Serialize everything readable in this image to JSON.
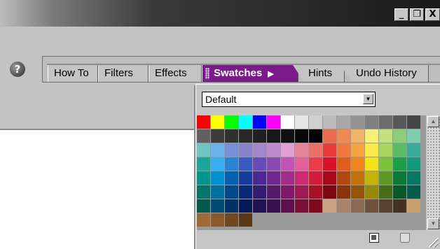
{
  "window": {
    "minimize_label": "_",
    "restore_label": "❐",
    "close_label": "X"
  },
  "help": {
    "label": "?"
  },
  "tabs": {
    "how_to": "How To",
    "filters": "Filters",
    "effects": "Effects",
    "swatches": "Swatches",
    "swatches_arrow": "▶",
    "hints": "Hints",
    "undo_history": "Undo History"
  },
  "swatch_panel": {
    "library_select_value": "Default",
    "select_arrow": "▼",
    "scroll_up": "▲",
    "scroll_down": "▼",
    "active_tab_color": "#7b1a8a",
    "swatches": [
      "#ff0000",
      "#ffff00",
      "#00ff00",
      "#00ffff",
      "#0000ff",
      "#ff00ff",
      "#ffffff",
      "#e6e6e6",
      "#d0d0d0",
      "#bcbcbc",
      "#a8a8a8",
      "#949494",
      "#808080",
      "#6c6c6c",
      "#585858",
      "#444444",
      "#606060",
      "#3c3c3c",
      "#303030",
      "#282828",
      "#202020",
      "#181818",
      "#101010",
      "#080808",
      "#000000",
      "#ea6c4c",
      "#ec8a52",
      "#f2b36a",
      "#f6ef7a",
      "#c2e07c",
      "#8cce7a",
      "#7ecfae",
      "#6ec6c2",
      "#6cb4e8",
      "#7690d6",
      "#8a82cc",
      "#a286c8",
      "#be8ace",
      "#e2a0d2",
      "#e6849a",
      "#ee6f6a",
      "#ea3a3a",
      "#f0783c",
      "#f7a23e",
      "#fcea4a",
      "#a8d65e",
      "#5cbc64",
      "#3aab9a",
      "#1ca69a",
      "#36aef2",
      "#2a84d6",
      "#3a5cc0",
      "#6a4ab6",
      "#8a4ab2",
      "#c254b8",
      "#e4609a",
      "#ea3c4c",
      "#d8122a",
      "#e25c1c",
      "#f0861c",
      "#f6e218",
      "#7cc23c",
      "#1c9e48",
      "#109a7a",
      "#00968a",
      "#0090d0",
      "#0062b0",
      "#183c9a",
      "#4a2a92",
      "#72288e",
      "#a22c8c",
      "#cc2a6e",
      "#d21c3c",
      "#a80a1c",
      "#b44612",
      "#c2700c",
      "#c2b408",
      "#5c9a24",
      "#0a7a36",
      "#087864",
      "#067468",
      "#00709e",
      "#004a8a",
      "#0a2a78",
      "#341c72",
      "#561a6e",
      "#7e1a6a",
      "#a01a52",
      "#a81228",
      "#7e0610",
      "#8a340a",
      "#94540a",
      "#948a06",
      "#466e18",
      "#085a28",
      "#065a4a",
      "#04584e",
      "#004c76",
      "#003264",
      "#061a56",
      "#221252",
      "#3a1050",
      "#5c104c",
      "#781038",
      "#7e0a1a",
      "#caa482",
      "#a8846a",
      "#8a6a52",
      "#6e523e",
      "#56402e",
      "#463222",
      "#caa06e",
      "#a06a36",
      "#8a5a2c",
      "#704820",
      "#583818"
    ]
  }
}
